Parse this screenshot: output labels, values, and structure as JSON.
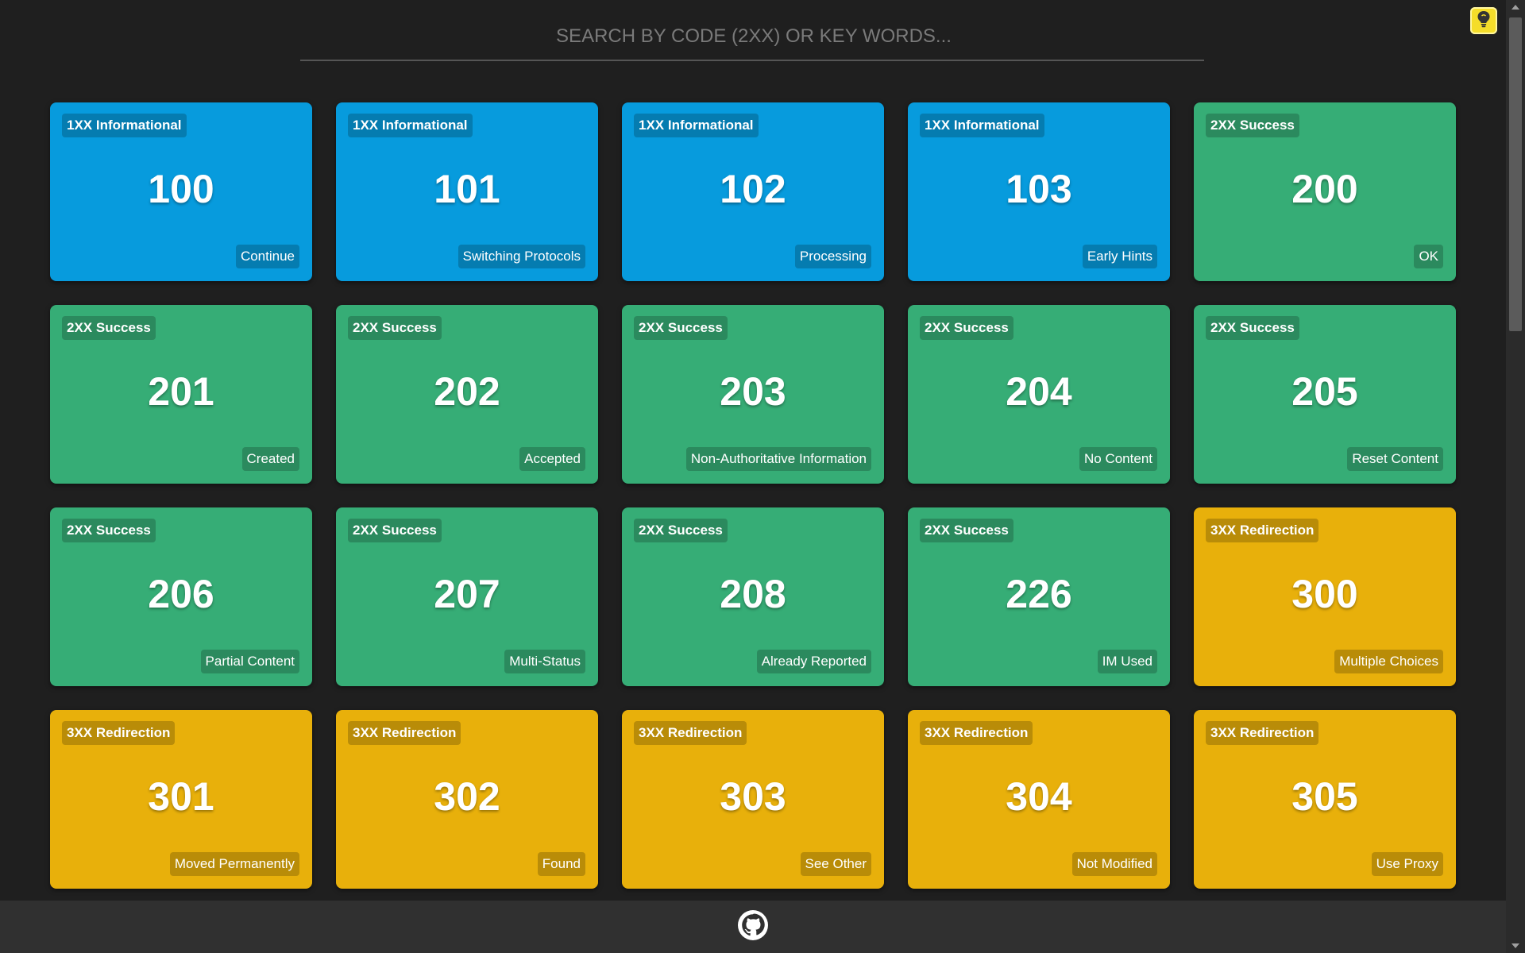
{
  "search": {
    "placeholder": "SEARCH BY CODE (2XX) OR KEY WORDS..."
  },
  "theme_toggle": {
    "icon": "lightbulb-icon",
    "color": "#f5dd2a"
  },
  "footer": {
    "icon": "github-icon"
  },
  "category_colors": {
    "1XX Informational": "#079bdd",
    "2XX Success": "#36ad76",
    "3XX Redirection": "#e8b00b"
  },
  "cards": [
    {
      "category": "1XX Informational",
      "code": "100",
      "text": "Continue"
    },
    {
      "category": "1XX Informational",
      "code": "101",
      "text": "Switching Protocols"
    },
    {
      "category": "1XX Informational",
      "code": "102",
      "text": "Processing"
    },
    {
      "category": "1XX Informational",
      "code": "103",
      "text": "Early Hints"
    },
    {
      "category": "2XX Success",
      "code": "200",
      "text": "OK"
    },
    {
      "category": "2XX Success",
      "code": "201",
      "text": "Created"
    },
    {
      "category": "2XX Success",
      "code": "202",
      "text": "Accepted"
    },
    {
      "category": "2XX Success",
      "code": "203",
      "text": "Non-Authoritative Information"
    },
    {
      "category": "2XX Success",
      "code": "204",
      "text": "No Content"
    },
    {
      "category": "2XX Success",
      "code": "205",
      "text": "Reset Content"
    },
    {
      "category": "2XX Success",
      "code": "206",
      "text": "Partial Content"
    },
    {
      "category": "2XX Success",
      "code": "207",
      "text": "Multi-Status"
    },
    {
      "category": "2XX Success",
      "code": "208",
      "text": "Already Reported"
    },
    {
      "category": "2XX Success",
      "code": "226",
      "text": "IM Used"
    },
    {
      "category": "3XX Redirection",
      "code": "300",
      "text": "Multiple Choices"
    },
    {
      "category": "3XX Redirection",
      "code": "301",
      "text": "Moved Permanently"
    },
    {
      "category": "3XX Redirection",
      "code": "302",
      "text": "Found"
    },
    {
      "category": "3XX Redirection",
      "code": "303",
      "text": "See Other"
    },
    {
      "category": "3XX Redirection",
      "code": "304",
      "text": "Not Modified"
    },
    {
      "category": "3XX Redirection",
      "code": "305",
      "text": "Use Proxy"
    }
  ]
}
